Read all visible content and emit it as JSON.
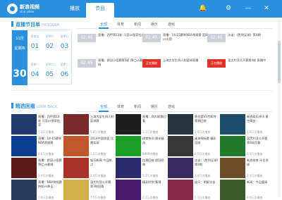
{
  "app": {
    "name": "新浪视频",
    "sub": "sina video"
  },
  "nav": {
    "tabs": [
      {
        "label": "播放"
      },
      {
        "label": "节目"
      }
    ]
  },
  "window_controls": {
    "bell": "🔔",
    "menu": "⚙",
    "minimize": "—",
    "close": "✕"
  },
  "live": {
    "title": "直播节目单",
    "title_en": "PROGRAM",
    "calendar": {
      "month": "11月",
      "weekday": "星期四",
      "day": "30",
      "cells": [
        {
          "w": "星期五",
          "n": "01"
        },
        {
          "w": "星期六",
          "n": "02"
        },
        {
          "w": "星期日",
          "n": "03"
        },
        {
          "w": "星期一",
          "n": "04"
        },
        {
          "w": "星期二",
          "n": "05"
        },
        {
          "w": "星期三",
          "n": "06"
        }
      ]
    },
    "filters": [
      "全部",
      "体育",
      "新闻",
      "娱乐",
      "游戏"
    ],
    "schedule": [
      {
        "time": "02:45",
        "text": "直播：西甲第13轮 马竞vs皇家社会"
      },
      {
        "time": "02:45",
        "text": "直播：14-15赛季NBA常规赛 篮网vs火箭"
      },
      {
        "time": "02:45",
        "text": "访谈：《胜利足球》第4期"
      },
      {
        "time": "02:45",
        "text": "直播：欧冠小组赛第5轮 拜仁vs曼城"
      },
      {
        "time": "正在播放",
        "text": "上海大学生四人制篮球直播",
        "live": true
      },
      {
        "time": "正在播放",
        "text": "温大利亚公开赛第4轮 直播中",
        "live": true
      }
    ]
  },
  "replay": {
    "title": "精选回看",
    "title_en": "LOOK BACK",
    "filters": [
      "全部",
      "体育",
      "新闻",
      "娱乐",
      "游戏"
    ],
    "cards": [
      {
        "cap": "直播：西甲第13轮 马竞vs皇家社会",
        "views": "7.3万次播放",
        "color": "#233a6e"
      },
      {
        "cap": "上海大学生四人制篮球赛",
        "views": "5.8万次播放",
        "color": "#7a2a2a"
      },
      {
        "cap": "直播：四大联赛回看",
        "views": "2.1万次播放",
        "color": "#1d1d1d"
      },
      {
        "cap": "蔡拉德VS劳斯特 视频回放",
        "views": "3.3万次播放",
        "color": "#26343f"
      },
      {
        "cap": "新浪娱乐快讯 星空舞台",
        "views": "1.9万次播放",
        "color": "#1f4e6a"
      },
      {
        "cap": "直播：14-15赛季NBA常规赛",
        "views": "4.6万次播放",
        "color": "#0b3d91"
      },
      {
        "cap": "2014中国男篮 比赛实录",
        "views": "1.2万次播放",
        "color": "#c1572a"
      },
      {
        "cap": "体育快讯 周末精选",
        "views": "8899次播放",
        "color": "#1a9e28"
      },
      {
        "cap": "桌球锦标赛 精彩回顾",
        "views": "9.5万次播放",
        "color": "#383838"
      },
      {
        "cap": "温大利亚公开赛 第4轮回看",
        "views": "6.1万次播放",
        "color": "#1f7a2a"
      },
      {
        "cap": "直播：欧冠小组赛 拜仁vs曼城",
        "views": "3.9万次播放",
        "color": "#5b1b1b"
      },
      {
        "cap": "娱乐新闻 今日热点",
        "views": "2.4万次播放",
        "color": "#a8322a"
      },
      {
        "cap": "比赛回放 欧冠经典",
        "views": "5.2万次播放",
        "color": "#2a2a6a"
      },
      {
        "cap": "访谈：《胜利足球》第4期",
        "views": "4.4万次播放",
        "color": "#3b2a5e"
      },
      {
        "cap": "新浪体育 十佳进球",
        "views": "3.1万次播放",
        "color": "#6a4b2a"
      },
      {
        "cap": "直播：NBA常规赛 快船vs勇士",
        "views": "1.6万次播放",
        "color": "#2a3b5e"
      },
      {
        "cap": "温大利亚公开赛 第3轮回看",
        "views": "7.7万次播放",
        "color": "#d2b04a"
      },
      {
        "cap": "精彩时刻 集锦",
        "views": "2.7万次播放",
        "color": "#4a1b6a"
      },
      {
        "cap": "娱乐：明星访谈",
        "views": "1.1万次播放",
        "color": "#8a2a4a"
      },
      {
        "cap": "新闻：今日要闻",
        "views": "9.9万次播放",
        "color": "#3a5a2a"
      }
    ]
  },
  "colors": {
    "accent": "#2b8fe0",
    "live": "#e2342a"
  }
}
